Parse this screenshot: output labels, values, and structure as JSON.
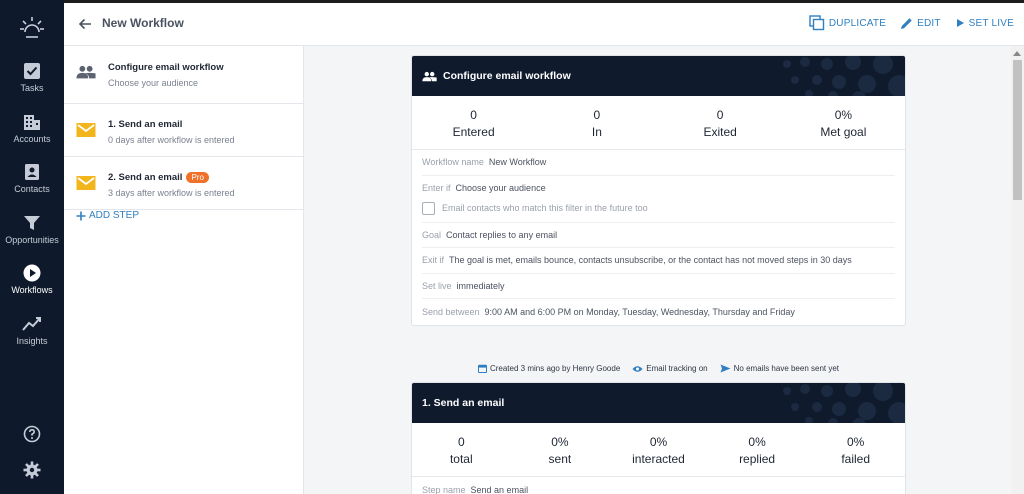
{
  "app": {
    "title": "New Workflow"
  },
  "rail": {
    "items": [
      {
        "label": "Tasks",
        "icon": "checkbox-icon"
      },
      {
        "label": "Accounts",
        "icon": "building-icon"
      },
      {
        "label": "Contacts",
        "icon": "contact-card-icon"
      },
      {
        "label": "Opportunities",
        "icon": "funnel-icon"
      },
      {
        "label": "Workflows",
        "icon": "play-circle-icon",
        "active": true
      },
      {
        "label": "Insights",
        "icon": "trend-line-icon"
      }
    ],
    "bottom": [
      {
        "icon": "help-icon"
      },
      {
        "icon": "gear-icon"
      }
    ]
  },
  "topbar": {
    "actions": {
      "duplicate": "DUPLICATE",
      "edit": "EDIT",
      "set_live": "SET LIVE"
    }
  },
  "steps": [
    {
      "title": "Configure email workflow",
      "subtitle": "Choose your audience",
      "icon": "people-icon"
    },
    {
      "title": "1. Send an email",
      "subtitle": "0 days after workflow is entered",
      "icon": "envelope-icon"
    },
    {
      "title": "2. Send an email",
      "subtitle": "3 days after workflow is entered",
      "icon": "envelope-icon",
      "badge": "Pro"
    }
  ],
  "add_step": "ADD STEP",
  "config_card": {
    "title": "Configure email workflow",
    "stats": [
      {
        "value": "0",
        "label": "Entered"
      },
      {
        "value": "0",
        "label": "In"
      },
      {
        "value": "0",
        "label": "Exited"
      },
      {
        "value": "0%",
        "label": "Met goal"
      }
    ],
    "details": {
      "workflow_name_key": "Workflow name",
      "workflow_name_val": "New Workflow",
      "enter_if_key": "Enter if",
      "enter_if_val": "Choose your audience",
      "future_check": "Email contacts who match this filter in the future too",
      "goal_key": "Goal",
      "goal_val": "Contact replies to any email",
      "exit_if_key": "Exit if",
      "exit_if_val": "The goal is met, emails bounce, contacts unsubscribe, or the contact has not moved steps in 30 days",
      "set_live_key": "Set live",
      "set_live_val": "immediately",
      "send_between_key": "Send between",
      "send_between_val": "9:00 AM and 6:00 PM on Monday, Tuesday, Wednesday, Thursday and Friday"
    }
  },
  "meta": {
    "created": "Created 3 mins ago by Henry Goode",
    "tracking": "Email tracking on",
    "sent": "No emails have been sent yet"
  },
  "email_card": {
    "title": "1. Send an email",
    "stats": [
      {
        "value": "0",
        "label": "total"
      },
      {
        "value": "0%",
        "label": "sent"
      },
      {
        "value": "0%",
        "label": "interacted"
      },
      {
        "value": "0%",
        "label": "replied"
      },
      {
        "value": "0%",
        "label": "failed"
      }
    ],
    "details": {
      "step_name_key": "Step name",
      "step_name_val": "Send an email"
    }
  },
  "colors": {
    "rail": "#0e1a2b",
    "accent": "#2f7fc1",
    "envelope": "#f3b51c",
    "pro": "#f0712a"
  }
}
